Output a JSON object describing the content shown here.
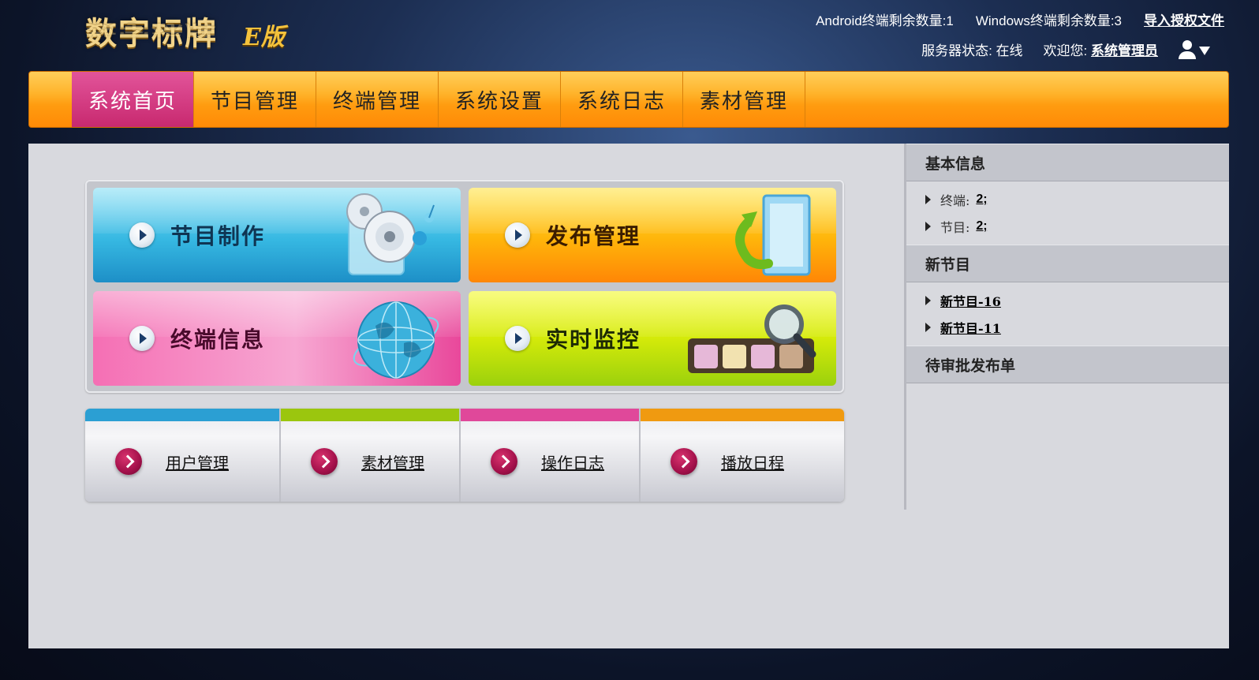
{
  "header": {
    "logo_text": "数字标牌",
    "logo_badge": "E版",
    "android_remaining": "Android终端剩余数量:1",
    "windows_remaining": "Windows终端剩余数量:3",
    "import_license": "导入授权文件",
    "server_status": "服务器状态: 在线",
    "welcome": "欢迎您:",
    "username": "系统管理员"
  },
  "nav": {
    "items": [
      {
        "label": "系统首页",
        "active": true
      },
      {
        "label": "节目管理"
      },
      {
        "label": "终端管理"
      },
      {
        "label": "系统设置"
      },
      {
        "label": "系统日志"
      },
      {
        "label": "素材管理"
      }
    ]
  },
  "tiles": [
    {
      "label": "节目制作",
      "icon": "disc-icon",
      "color": "#36b8e2"
    },
    {
      "label": "发布管理",
      "icon": "publish-icon",
      "color": "#ffb40a"
    },
    {
      "label": "终端信息",
      "icon": "globe-icon",
      "color": "#f56fb4"
    },
    {
      "label": "实时监控",
      "icon": "monitor-magnifier-icon",
      "color": "#d4ea0a"
    }
  ],
  "quick_links": [
    {
      "label": "用户管理",
      "color": "#2b9fd3"
    },
    {
      "label": "素材管理",
      "color": "#9bc60e"
    },
    {
      "label": "操作日志",
      "color": "#e0489a"
    },
    {
      "label": "播放日程",
      "color": "#f09a10"
    }
  ],
  "sidebar": {
    "basic_info_title": "基本信息",
    "terminal_label": "终端:",
    "terminal_value": "2;",
    "program_label": "节目:",
    "program_value": "2;",
    "new_program_title": "新节目",
    "new_programs": [
      "新节目-16",
      "新节目-11"
    ],
    "pending_title": "待审批发布单"
  }
}
